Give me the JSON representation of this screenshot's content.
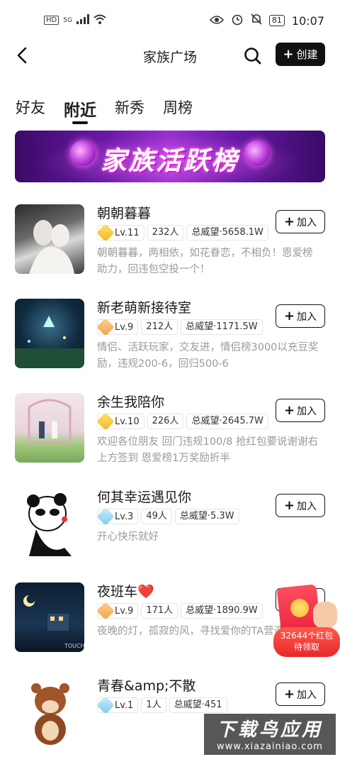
{
  "status_bar": {
    "left": "HD",
    "signal": "5G",
    "battery": "81",
    "time": "10:07"
  },
  "header": {
    "title": "家族广场",
    "create_label": "创建"
  },
  "tabs": [
    {
      "label": "好友"
    },
    {
      "label": "附近"
    },
    {
      "label": "新秀"
    },
    {
      "label": "周榜"
    }
  ],
  "banner": {
    "text": "家族活跃榜"
  },
  "families": [
    {
      "name": "朝朝暮暮",
      "level": "Lv.11",
      "members": "232人",
      "prestige": "总威望·5658.1W",
      "desc": "朝朝暮暮，两相依，如花眷恋，不相负！恩爱榜助力，回违包空投一个！",
      "join": "加入"
    },
    {
      "name": "新老萌新接待室",
      "level": "Lv.9",
      "members": "212人",
      "prestige": "总威望·1171.5W",
      "desc": "情侣、活跃玩家，交友进，情侣榜3000以充豆奖励，违规200-6，回归500-6",
      "join": "加入"
    },
    {
      "name": "余生我陪你",
      "level": "Lv.10",
      "members": "226人",
      "prestige": "总威望·2645.7W",
      "desc": "欢迎各位朋友 回门违规100/8 抢红包要说谢谢右上方签到 恩爱榜1万奖励折半",
      "join": "加入"
    },
    {
      "name": "何其幸运遇见你",
      "level": "Lv.3",
      "members": "49人",
      "prestige": "总威望·5.3W",
      "desc": "开心快乐就好",
      "join": "加入"
    },
    {
      "name": "夜班车❤️",
      "level": "Lv.9",
      "members": "171人",
      "prestige": "总威望·1890.9W",
      "desc": "夜晚的灯，孤寂的风，寻找爱你的TA营造大家庭",
      "join": "加入"
    },
    {
      "name": "青春&amp;不散",
      "level": "Lv.1",
      "members": "1人",
      "prestige": "总威望·451",
      "desc": "",
      "join": "加入"
    }
  ],
  "red_packet": {
    "line1": "32644个红包",
    "line2": "待领取"
  },
  "watermark": {
    "title": "下载鸟应用",
    "sub": "www.xiazainiao.com"
  }
}
